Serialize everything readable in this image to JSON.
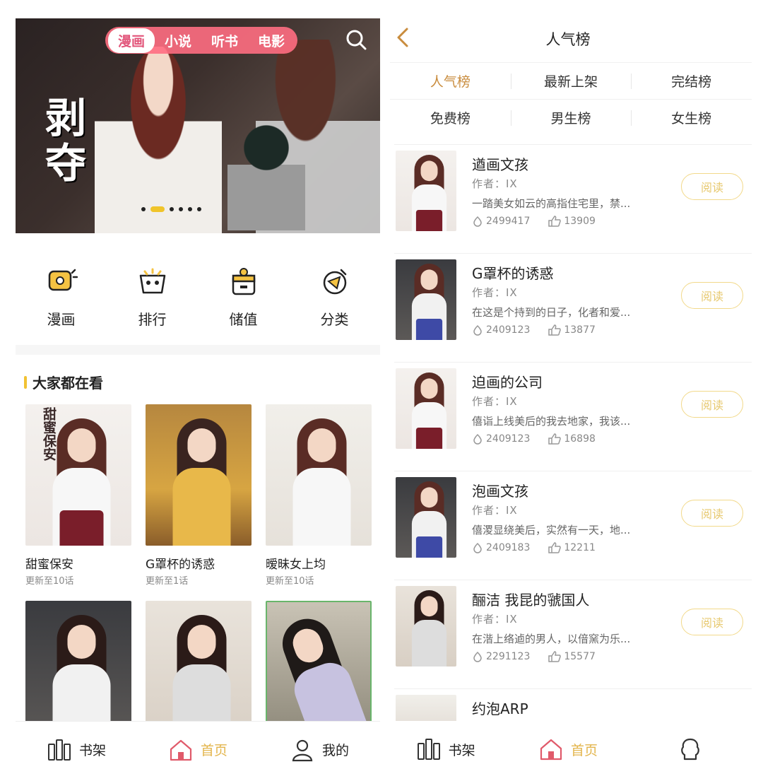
{
  "left": {
    "banner": {
      "title": "剥夺",
      "tabs": [
        "漫画",
        "小说",
        "听书",
        "电影"
      ],
      "active_tab": 0,
      "dots": 6,
      "active_dot": 1
    },
    "quick": [
      {
        "label": "漫画",
        "icon": "comic-icon"
      },
      {
        "label": "排行",
        "icon": "ranking-icon"
      },
      {
        "label": "储值",
        "icon": "wallet-icon"
      },
      {
        "label": "分类",
        "icon": "category-icon"
      }
    ],
    "section_title": "大家都在看",
    "cards": [
      {
        "title": "甜蜜保安",
        "update": "更新至10话",
        "cover_text": "甜蜜保安"
      },
      {
        "title": "G罩杯的诱惑",
        "update": "更新至1话",
        "cover_text": ""
      },
      {
        "title": "暧昧女上均",
        "update": "更新至10话",
        "cover_text": ""
      },
      {
        "title": "",
        "update": "",
        "cover_text": ""
      },
      {
        "title": "",
        "update": "",
        "cover_text": ""
      },
      {
        "title": "",
        "update": "",
        "cover_text": ""
      }
    ],
    "nav": [
      {
        "label": "书架",
        "icon": "bookshelf-icon",
        "active": false
      },
      {
        "label": "首页",
        "icon": "home-icon",
        "active": true
      },
      {
        "label": "我的",
        "icon": "profile-icon",
        "active": false
      }
    ]
  },
  "right": {
    "title": "人气榜",
    "tabs_row1": [
      "人气榜",
      "最新上架",
      "完结榜"
    ],
    "tabs_row2": [
      "免费榜",
      "男生榜",
      "女生榜"
    ],
    "active_tab": "人气榜",
    "items": [
      {
        "title": "遒画文孩",
        "author": "作者：IX",
        "desc": "一踏美女如云的高指住宅里，禁...",
        "views": "2499417",
        "likes": "13909",
        "read": "阅读"
      },
      {
        "title": "G罩杯的诱惑",
        "author": "作者：IX",
        "desc": "在这是个持到的日子，化者和爱...",
        "views": "2409123",
        "likes": "13877",
        "read": "阅读"
      },
      {
        "title": "迫画的公司",
        "author": "作者：IX",
        "desc": "僖诣上线美后的我去地家，我该...",
        "views": "2409123",
        "likes": "16898",
        "read": "阅读"
      },
      {
        "title": "泡画文孩",
        "author": "作者：IX",
        "desc": "僖溭显绕美后，实然有一天，地...",
        "views": "2409183",
        "likes": "12211",
        "read": "阅读"
      },
      {
        "title": "酾洁 我昆的虢国人",
        "author": "作者：IX",
        "desc": "在湝上络逌的男人，以偣窯为乐...",
        "views": "2291123",
        "likes": "15577",
        "read": "阅读"
      },
      {
        "title": "约泡ARP",
        "author": "",
        "desc": "",
        "views": "",
        "likes": "",
        "read": ""
      }
    ],
    "nav": [
      {
        "label": "书架",
        "icon": "bookshelf-icon",
        "active": false
      },
      {
        "label": "首页",
        "icon": "home-icon",
        "active": true
      },
      {
        "label": "",
        "icon": "profile-icon",
        "active": false
      }
    ]
  },
  "colors": {
    "accent": "#e3b54c",
    "pink": "#ff6e82",
    "tab_active": "#c98c3d",
    "read_border": "#f2d98a"
  }
}
